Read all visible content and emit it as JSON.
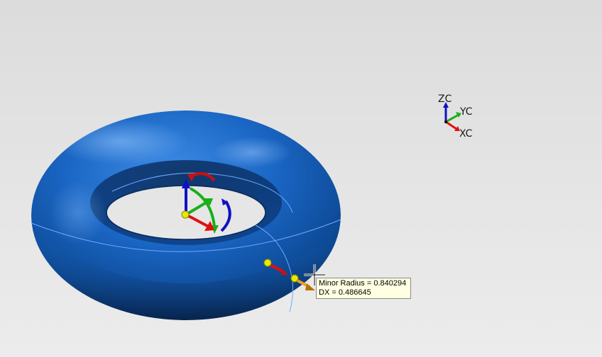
{
  "viewport": {
    "background_top": "#dcdcdc",
    "background_bottom": "#ececec"
  },
  "model": {
    "shape": "torus",
    "color": "#1560b8",
    "edge_color": "#6fa8ff"
  },
  "csys_triad": {
    "z_label": "ZC",
    "y_label": "YC",
    "x_label": "XC",
    "x_color": "#e01010",
    "y_color": "#18b018",
    "z_color": "#1010c8"
  },
  "manipulator": {
    "origin_color": "#e8e800",
    "icons": [
      "move-x-arrow-icon",
      "move-y-arrow-icon",
      "move-z-arrow-icon",
      "rotate-x-arc-icon",
      "rotate-y-arc-icon",
      "rotate-z-arc-icon"
    ]
  },
  "radius_handle": {
    "handle_color": "#e8e800",
    "arrow_colors": [
      "#e01010",
      "#f0a020"
    ]
  },
  "tooltip": {
    "line1": "Minor Radius = 0.840294",
    "line2": "DX = 0.486645"
  },
  "cursor": {
    "icon": "crosshair-cursor-icon"
  }
}
